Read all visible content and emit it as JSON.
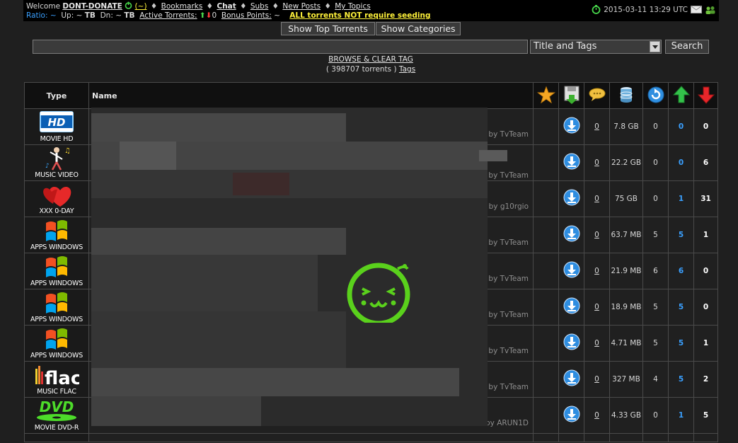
{
  "topbar": {
    "welcome_label": "Welcome",
    "username": "DONT-DONATE",
    "tilde_link": "(~)",
    "bookmarks": "Bookmarks",
    "chat": "Chat",
    "subs": "Subs",
    "new_posts": "New Posts",
    "my_topics": "My Topics",
    "ratio_label": "Ratio:",
    "ratio_value": "~",
    "up_label": "Up:",
    "up_value": "~",
    "tb1": "TB",
    "dn_label": "Dn:",
    "dn_value": "~",
    "tb2": "TB",
    "active_torrents_label": "Active Torrents:",
    "active_torrents_value": "0",
    "bonus_points_label": "Bonus Points:",
    "bonus_points_value": "~",
    "seeding_notice": "ALL torrents NOT require seeding",
    "datetime": "2015-03-11 13:29 UTC"
  },
  "buttons": {
    "top_torrents": "Show Top Torrents",
    "categories": "Show Categories"
  },
  "search": {
    "select_value": "Title and Tags",
    "button_label": "Search"
  },
  "browse": {
    "clear_tag": "BROWSE & CLEAR TAG",
    "count_prefix": "( 398707 torrents )",
    "tags_link": "Tags"
  },
  "table": {
    "headers": {
      "type": "Type",
      "name": "Name"
    },
    "rows": [
      {
        "category": "MOVIE HD",
        "icon": "hd-movie-icon",
        "uploader": "o by TvTeam",
        "comments": "0",
        "size": "7.8 GB",
        "snatched": "0",
        "seeders": "0",
        "leechers": "0"
      },
      {
        "category": "MUSIC VIDEO",
        "icon": "music-video-icon",
        "uploader": "o by TvTeam",
        "comments": "0",
        "size": "22.2 GB",
        "snatched": "0",
        "seeders": "0",
        "leechers": "6"
      },
      {
        "category": "XXX 0-DAY",
        "icon": "heart-icon",
        "uploader": "o by g10rgio",
        "comments": "0",
        "size": "75 GB",
        "snatched": "0",
        "seeders": "1",
        "leechers": "31"
      },
      {
        "category": "APPS WINDOWS",
        "icon": "windows-icon",
        "uploader": "o by TvTeam",
        "comments": "0",
        "size": "63.7 MB",
        "snatched": "5",
        "seeders": "5",
        "leechers": "1"
      },
      {
        "category": "APPS WINDOWS",
        "icon": "windows-icon",
        "uploader": "o by TvTeam",
        "comments": "0",
        "size": "21.9 MB",
        "snatched": "6",
        "seeders": "6",
        "leechers": "0"
      },
      {
        "category": "APPS WINDOWS",
        "icon": "windows-icon",
        "uploader": "o by TvTeam",
        "comments": "0",
        "size": "18.9 MB",
        "snatched": "5",
        "seeders": "5",
        "leechers": "0"
      },
      {
        "category": "APPS WINDOWS",
        "icon": "windows-icon",
        "uploader": "o by TvTeam",
        "comments": "0",
        "size": "4.71 MB",
        "snatched": "5",
        "seeders": "5",
        "leechers": "1"
      },
      {
        "category": "MUSIC FLAC",
        "icon": "flac-icon",
        "uploader": "o by TvTeam",
        "comments": "0",
        "size": "327 MB",
        "snatched": "4",
        "seeders": "5",
        "leechers": "2"
      },
      {
        "category": "MOVIE DVD-R",
        "icon": "dvd-icon",
        "uploader": "by ARUN1D",
        "comments": "0",
        "size": "4.33 GB",
        "snatched": "0",
        "seeders": "1",
        "leechers": "5"
      }
    ]
  },
  "colors": {
    "background": "#1f1f1f",
    "topbar": "#000000",
    "seeders": "#3aa0ff",
    "notice": "#fff23a",
    "smiley": "#5ad11c"
  }
}
